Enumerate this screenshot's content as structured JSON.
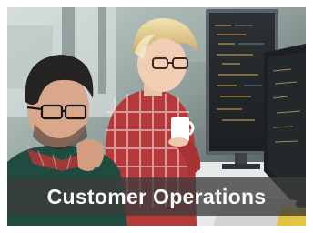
{
  "card": {
    "caption": "Customer Operations",
    "image_subject": "two people working at computer monitors",
    "caption_bar_color": "#3c3c3c",
    "caption_text_color": "#ffffff"
  }
}
